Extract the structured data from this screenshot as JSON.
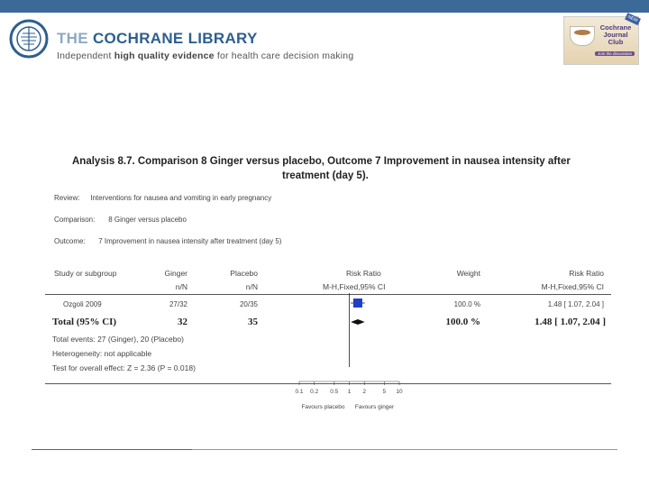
{
  "header": {
    "library_pre": "THE",
    "library_name": "COCHRANE LIBRARY",
    "tagline_1": "Independent",
    "tagline_2": "high quality evidence",
    "tagline_3": "for health care decision making"
  },
  "journal_club": {
    "line1": "Cochrane",
    "line2": "Journal",
    "line3": "Club",
    "sub": "Join the discussion",
    "badge": "NEW"
  },
  "analysis": {
    "title_line1": "Analysis 8.7.   Comparison 8 Ginger versus placebo, Outcome 7 Improvement in nausea intensity after",
    "title_line2": "treatment (day 5).",
    "review_k": "Review:",
    "review_v": "Interventions for nausea and vomiting in early pregnancy",
    "comparison_k": "Comparison:",
    "comparison_v": "8 Ginger versus placebo",
    "outcome_k": "Outcome:",
    "outcome_v": "7 Improvement in nausea intensity after treatment (day 5)"
  },
  "columns": {
    "study": "Study or subgroup",
    "ginger": "Ginger",
    "ginger_sub": "n/N",
    "placebo": "Placebo",
    "placebo_sub": "n/N",
    "rr": "Risk Ratio",
    "rr_sub": "M-H,Fixed,95% CI",
    "weight": "Weight",
    "rr2": "Risk Ratio",
    "rr2_sub": "M-H,Fixed,95% CI"
  },
  "rows": [
    {
      "study": "Ozgoli 2009",
      "ginger": "27/32",
      "placebo": "20/35",
      "weight": "100.0 %",
      "rr": "1.48 [ 1.07, 2.04 ]",
      "point": 1.48,
      "lo": 1.07,
      "hi": 2.04
    }
  ],
  "total": {
    "label": "Total (95% CI)",
    "ginger": "32",
    "placebo": "35",
    "weight": "100.0 %",
    "rr": "1.48 [ 1.07, 2.04 ]",
    "point": 1.48,
    "lo": 1.07,
    "hi": 2.04
  },
  "footer": {
    "events": "Total events: 27 (Ginger), 20 (Placebo)",
    "heterogeneity": "Heterogeneity: not applicable",
    "overall": "Test for overall effect: Z = 2.36 (P = 0.018)"
  },
  "axis": {
    "ticks": [
      0.1,
      0.2,
      0.5,
      1,
      2,
      5,
      10
    ],
    "tick_labels": [
      "0.1",
      "0.2",
      "0.5",
      "1",
      "2",
      "5",
      "10"
    ],
    "left_label": "Favours placebo",
    "right_label": "Favours ginger",
    "scale": "log"
  },
  "colors": {
    "brand": "#3b6a99",
    "study_marker": "#1f3fc8",
    "diamond": "#111111"
  }
}
